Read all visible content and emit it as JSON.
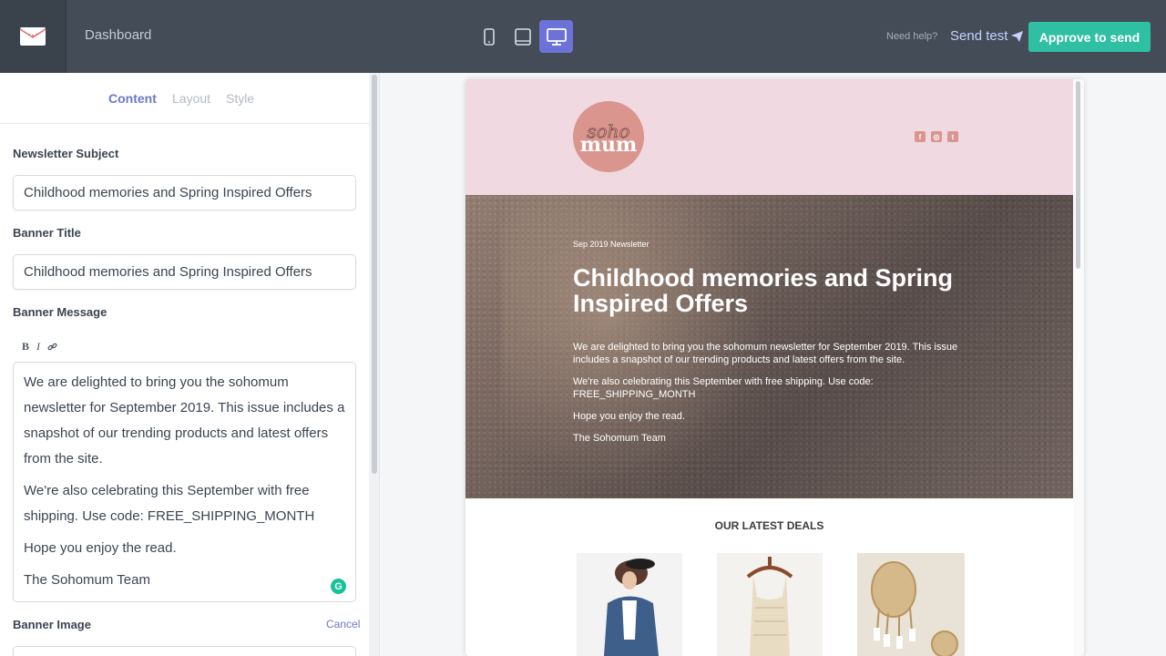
{
  "topbar": {
    "dashboard_label": "Dashboard",
    "need_help": "Need help?",
    "send_test": "Send test",
    "approve": "Approve to send",
    "active_device": "desktop"
  },
  "tabs": [
    {
      "label": "Content",
      "active": true
    },
    {
      "label": "Layout",
      "active": false
    },
    {
      "label": "Style",
      "active": false
    }
  ],
  "form": {
    "subject_label": "Newsletter Subject",
    "subject_value": "Childhood memories and Spring Inspired Offers",
    "banner_title_label": "Banner Title",
    "banner_title_value": "Childhood memories and Spring Inspired Offers",
    "banner_message_label": "Banner Message",
    "toolbar": {
      "bold": "B",
      "italic": "I"
    },
    "banner_message": [
      "We are delighted to bring you the sohomum newsletter for September 2019. This issue includes a snapshot of our trending products and latest offers from the site.",
      "We're also celebrating this September with free shipping. Use code: FREE_SHIPPING_MONTH",
      "Hope you enjoy the read.",
      "The Sohomum Team"
    ],
    "grammarly": "G",
    "banner_image_label": "Banner Image",
    "cancel": "Cancel"
  },
  "email": {
    "brand_script": "soho",
    "brand_word": "mum",
    "social": [
      "f",
      "◎",
      "t"
    ],
    "banner_date": "Sep 2019 Newsletter",
    "banner_title": "Childhood memories and Spring Inspired Offers",
    "banner_message": [
      "We are delighted to bring you the sohomum newsletter for September 2019. This issue includes a snapshot of our trending products and latest offers from the site.",
      "We're also celebrating this September with free shipping. Use code: FREE_SHIPPING_MONTH",
      "Hope you enjoy the read.",
      "The Sohomum Team"
    ],
    "deals_title": "OUR LATEST DEALS",
    "products": [
      {
        "name": "denim-jacket-product"
      },
      {
        "name": "knit-top-product"
      },
      {
        "name": "rattan-earrings-product"
      }
    ]
  },
  "colors": {
    "topbar": "#434c57",
    "accent": "#6d72d8",
    "approve": "#2fbfa3",
    "email_header": "#f0d9e0",
    "brand": "#d9958e"
  }
}
